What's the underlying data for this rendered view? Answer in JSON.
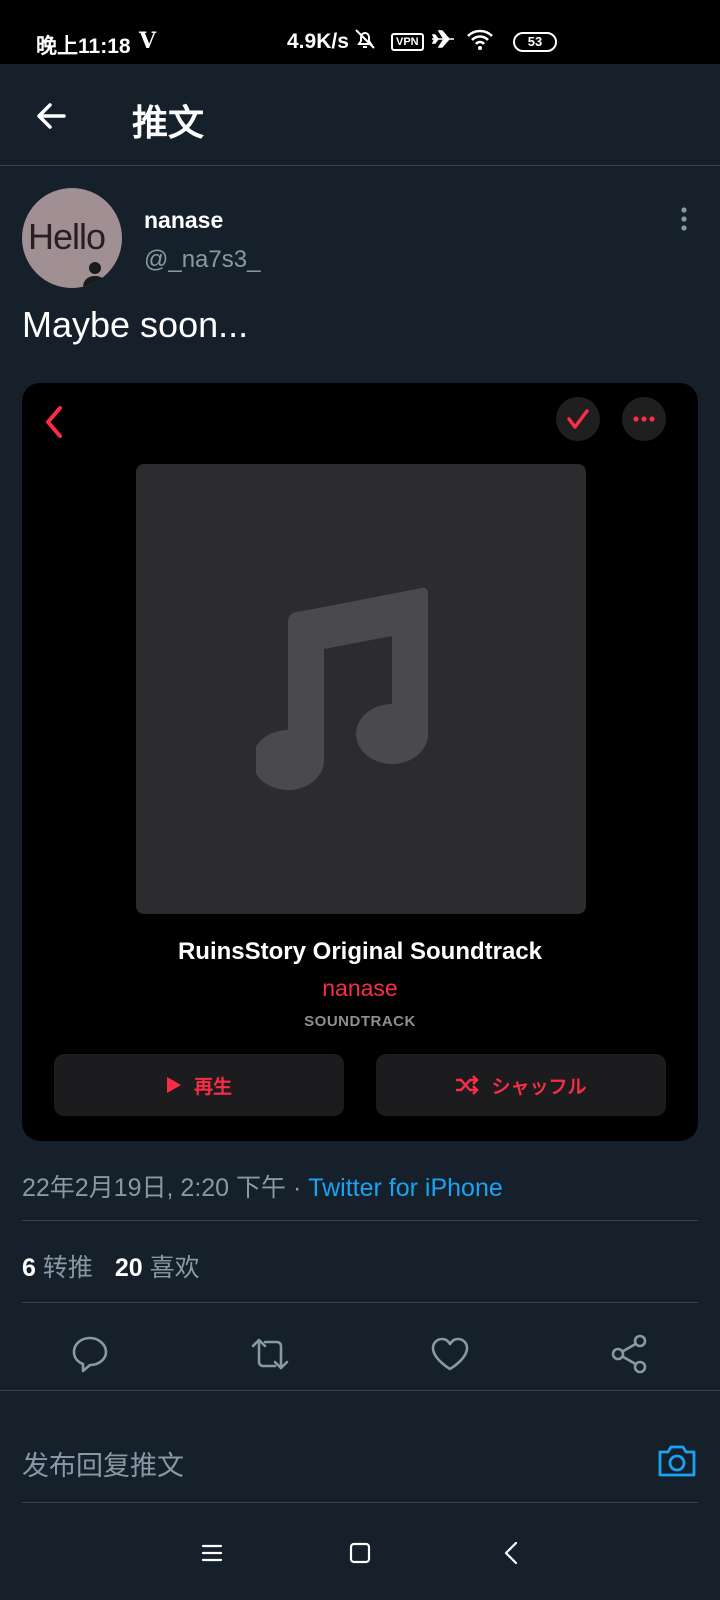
{
  "status_bar": {
    "time": "晚上11:18",
    "carrier_icon": "V",
    "speed": "4.9K/s",
    "vpn": "VPN",
    "battery": "53",
    "icons": [
      "mute-icon",
      "airplane-icon",
      "wifi-icon",
      "battery-icon"
    ]
  },
  "header": {
    "title": "推文"
  },
  "tweet": {
    "avatar_text": "Hello",
    "display_name": "nanase",
    "handle": "@_na7s3_",
    "text": "Maybe soon...",
    "timestamp": "22年2月19日, 2:20 下午 · ",
    "source": "Twitter for iPhone"
  },
  "card": {
    "album_title": "RuinsStory Original Soundtrack",
    "artist": "nanase",
    "genre": "SOUNDTRACK",
    "play_label": "再生",
    "shuffle_label": "シャッフル"
  },
  "stats": {
    "retweets_count": "6",
    "retweets_label": "转推",
    "likes_count": "20",
    "likes_label": "喜欢"
  },
  "reply": {
    "placeholder": "发布回复推文"
  },
  "colors": {
    "background": "#15202b",
    "accent_blue": "#1da1f2",
    "music_red": "#fa2d48",
    "muted_text": "#8899a6",
    "divider": "#38444d"
  }
}
